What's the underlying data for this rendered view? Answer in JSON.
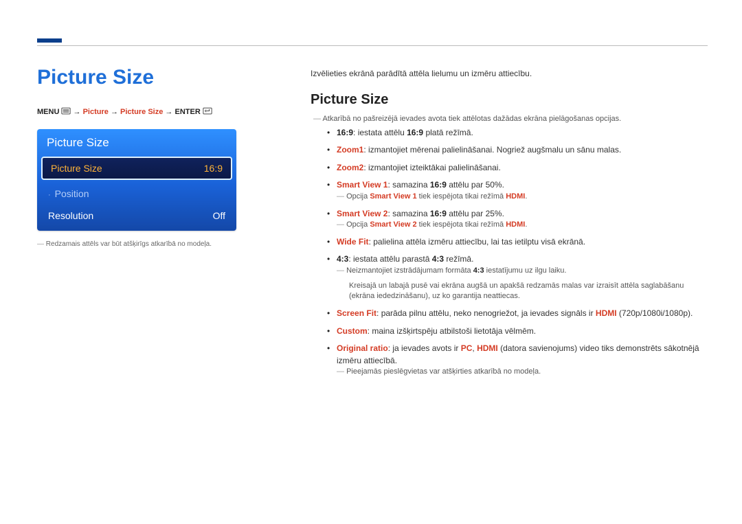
{
  "left": {
    "title": "Picture Size",
    "breadcrumb": {
      "menu": "MENU",
      "arrow": "→",
      "picture": "Picture",
      "picture_size": "Picture Size",
      "enter": "ENTER"
    },
    "osd": {
      "title": "Picture Size",
      "rows": [
        {
          "label": "Picture Size",
          "value": "16:9",
          "selected": true
        },
        {
          "label": "Position",
          "value": "",
          "dim": true,
          "arrow": true
        },
        {
          "label": "Resolution",
          "value": "Off"
        }
      ]
    },
    "note": "Redzamais attēls var būt atšķirīgs atkarībā no modeļa."
  },
  "right": {
    "intro": "Izvēlieties ekrānā parādītā attēla lielumu un izmēru attiecību.",
    "title": "Picture Size",
    "top_note": "Atkarībā no pašreizējā ievades avota tiek attēlotas dažādas ekrāna pielāgošanas opcijas.",
    "items": {
      "i169_name": "16:9",
      "i169_text": ": iestata attēlu ",
      "i169_mid": "16:9",
      "i169_end": " platā režīmā.",
      "zoom1_name": "Zoom1",
      "zoom1_text": ": izmantojiet mērenai palielināšanai. Nogriež augšmalu un sānu malas.",
      "zoom2_name": "Zoom2",
      "zoom2_text": ": izmantojiet izteiktākai palielināšanai.",
      "sv1_name": "Smart View 1",
      "sv1_text": ": samazina ",
      "sv1_mid": "16:9",
      "sv1_end": " attēlu par 50%.",
      "sv1_note_a": "Opcija ",
      "sv1_note_b": "Smart View 1",
      "sv1_note_c": " tiek iespējota tikai režīmā ",
      "sv1_note_d": "HDMI",
      "sv1_note_e": ".",
      "sv2_name": "Smart View 2",
      "sv2_text": ": samazina ",
      "sv2_mid": "16:9",
      "sv2_end": " attēlu par 25%.",
      "sv2_note_a": "Opcija ",
      "sv2_note_b": "Smart View 2",
      "sv2_note_c": " tiek iespējota tikai režīmā ",
      "sv2_note_d": "HDMI",
      "sv2_note_e": ".",
      "wide_name": "Wide Fit",
      "wide_text": ": palielina attēla izmēru attiecību, lai tas ietilptu visā ekrānā.",
      "i43_name": "4:3",
      "i43_text": ": iestata attēlu parastā ",
      "i43_mid": "4:3",
      "i43_end": " režīmā.",
      "i43_note_a": "Neizmantojiet izstrādājumam formāta ",
      "i43_note_b": "4:3",
      "i43_note_c": " iestatījumu uz ilgu laiku.",
      "i43_para": "Kreisajā un labajā pusē vai ekrāna augšā un apakšā redzamās malas var izraisīt attēla saglabāšanu (ekrāna iededzināšanu), uz ko garantija neattiecas.",
      "sf_name": "Screen Fit",
      "sf_text_a": ": parāda pilnu attēlu, neko nenogriežot, ja ievades signāls ir ",
      "sf_text_b": "HDMI",
      "sf_text_c": " (720p/1080i/1080p).",
      "custom_name": "Custom",
      "custom_text": ": maina izšķirtspēju atbilstoši lietotāja vēlmēm.",
      "orig_name": "Original ratio",
      "orig_text_a": ": ja ievades avots ir ",
      "orig_pc": "PC",
      "orig_comma": ", ",
      "orig_hdmi": "HDMI",
      "orig_text_b": " (datora savienojums) video tiks demonstrēts sākotnējā izmēru attiecībā.",
      "bottom_note": "Pieejamās pieslēgvietas var atšķirties atkarībā no modeļa."
    }
  }
}
